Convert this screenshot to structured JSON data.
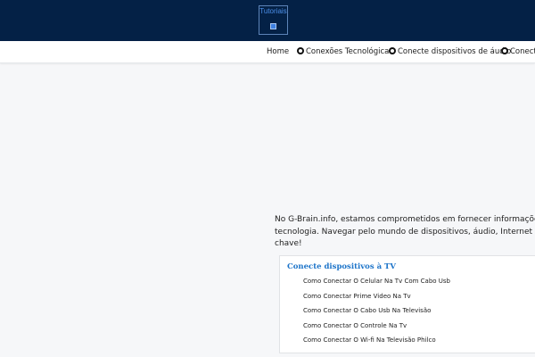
{
  "header": {
    "logo_text": "Tutoriais"
  },
  "nav": {
    "items": [
      {
        "label": "Home"
      },
      {
        "label": "Conexões Tecnológicas"
      },
      {
        "label": "Conecte dispositivos de áudio"
      },
      {
        "label": "Conecte"
      }
    ]
  },
  "intro": {
    "line1": "No G-Brain.info, estamos comprometidos em fornecer informações valiosas",
    "line2": "tecnologia. Navegar pelo mundo de dispositivos, áudio, Internet e conexões",
    "line3": "chave!"
  },
  "card": {
    "title": "Conecte dispositivos à TV",
    "links": [
      "Como Conectar O Celular Na Tv Com Cabo Usb",
      "Como Conectar Prime Video Na Tv",
      "Como Conectar O Cabo Usb Na Televisão",
      "Como Conectar O Controle Na Tv",
      "Como Conectar O Wi-fi Na Televisão Philco"
    ]
  },
  "colors": {
    "header_bg": "#042146",
    "accent": "#1d74c9",
    "page_bg": "#f6f7f9"
  }
}
